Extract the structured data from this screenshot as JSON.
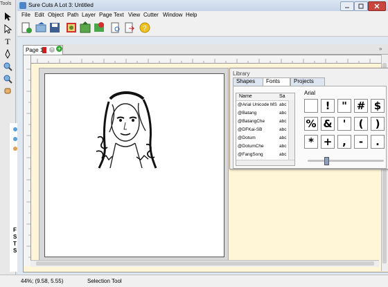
{
  "tools_palette": {
    "title": "Tools"
  },
  "behind_window": {
    "letters": [
      "F",
      "S",
      "T",
      "S"
    ]
  },
  "window": {
    "title": "Sure Cuts A Lot 3: Untitled",
    "menu": [
      "File",
      "Edit",
      "Object",
      "Path",
      "Layer",
      "Page",
      "Text",
      "View",
      "Cutter",
      "Window",
      "Help"
    ]
  },
  "tabs": {
    "page_tab": "Page 1"
  },
  "library": {
    "title": "Library",
    "tabs": [
      "Shapes",
      "Fonts",
      "Projects"
    ],
    "columns": [
      "Name",
      "Sa"
    ],
    "fonts": [
      {
        "name": "@Arial Unicode MS",
        "sample": "abc"
      },
      {
        "name": "@Batang",
        "sample": "abc"
      },
      {
        "name": "@BatangChe",
        "sample": "abc"
      },
      {
        "name": "@DFKai-SB",
        "sample": "abc"
      },
      {
        "name": "@Dotum",
        "sample": "abc"
      },
      {
        "name": "@DotumChe",
        "sample": "abc"
      },
      {
        "name": "@FangSong",
        "sample": "abc"
      }
    ],
    "selected_font": "Arial",
    "glyphs": [
      "",
      "!",
      "\"",
      "#",
      "$",
      "%",
      "&",
      "'",
      "(",
      ")",
      "*",
      "+",
      ",",
      "-",
      "."
    ]
  },
  "status": {
    "zoom": "44%; (9.58, 5.55)",
    "tool": "Selection Tool"
  },
  "colors": {
    "workspace": "#fff6d7",
    "accent": "#2a66b8"
  }
}
